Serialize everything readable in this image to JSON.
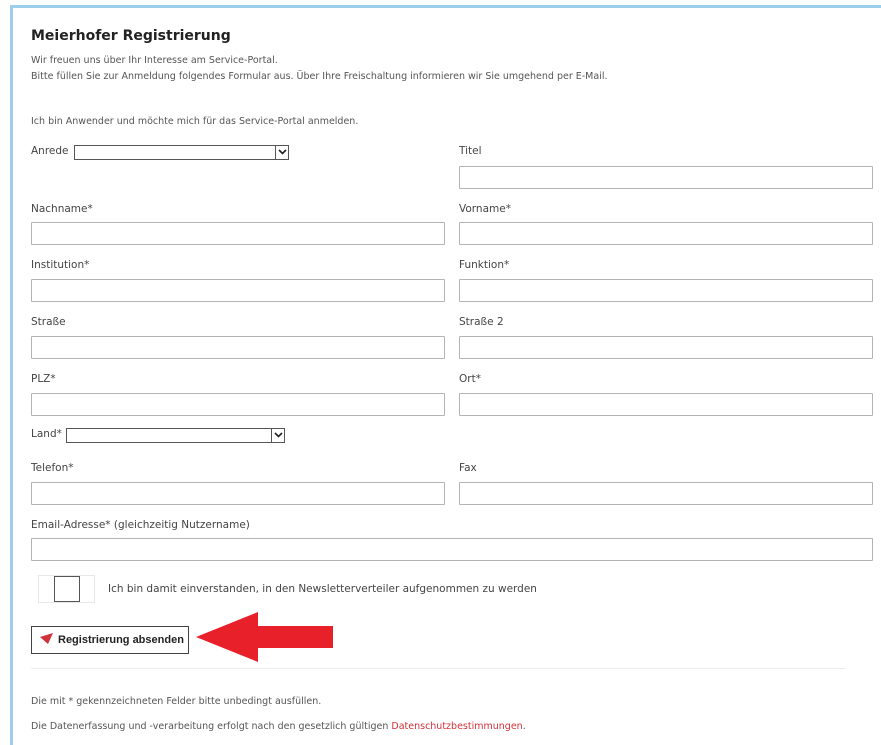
{
  "header": {
    "title": "Meierhofer Registrierung",
    "intro_line1": "Wir freuen uns über Ihr Interesse am Service-Portal.",
    "intro_line2": "Bitte füllen Sie zur Anmeldung folgendes Formular aus. Über Ihre Freischaltung informieren wir Sie umgehend per E-Mail.",
    "role_line": "Ich bin Anwender und möchte mich für das Service-Portal anmelden."
  },
  "form": {
    "anrede_label": "Anrede",
    "anrede_value": "",
    "titel_label": "Titel",
    "nachname_label": "Nachname*",
    "vorname_label": "Vorname*",
    "institution_label": "Institution*",
    "funktion_label": "Funktion*",
    "strasse_label": "Straße",
    "strasse2_label": "Straße 2",
    "plz_label": "PLZ*",
    "ort_label": "Ort*",
    "land_label": "Land*",
    "land_value": "",
    "telefon_label": "Telefon*",
    "fax_label": "Fax",
    "email_label": "Email-Adresse* (gleichzeitig Nutzername)",
    "newsletter_label": "Ich bin damit einverstanden, in den Newsletterverteiler aufgenommen zu werden",
    "newsletter_checked": false,
    "submit_label": "Registrierung absenden"
  },
  "footer": {
    "required_note": "Die mit * gekennzeichneten Felder bitte unbedingt ausfüllen.",
    "privacy_text": "Die Datenerfassung und -verarbeitung erfolgt nach den gesetzlich gültigen ",
    "privacy_link": "Datenschutzbestimmungen",
    "privacy_end": "."
  },
  "icons": {
    "submit_icon": "red-triangle-pointer-icon",
    "select_arrow": "chevron-down-icon",
    "annotation": "red-arrow-icon"
  },
  "colors": {
    "frame": "#9dcfec",
    "accent_red": "#d0323a",
    "annotation_red": "#e8202a"
  }
}
